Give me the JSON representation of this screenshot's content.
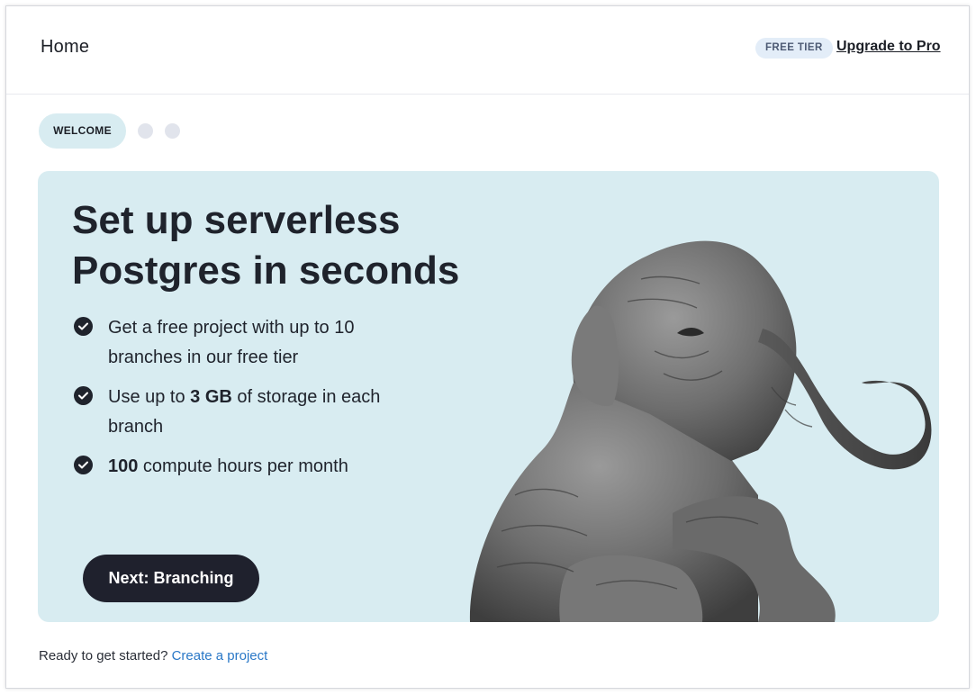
{
  "header": {
    "title": "Home",
    "tier_badge": "FREE TIER",
    "upgrade_link": "Upgrade to Pro"
  },
  "stepper": {
    "active_step": "WELCOME",
    "total_steps": 3,
    "active_index": 0
  },
  "hero": {
    "title_line1": "Set up serverless",
    "title_line2": "Postgres in seconds",
    "features": [
      {
        "prefix": "Get a free project with up to 10 branches in our free tier",
        "bold": "",
        "suffix": ""
      },
      {
        "prefix": "Use up to ",
        "bold": "3 GB",
        "suffix": " of storage in each branch"
      },
      {
        "prefix": "",
        "bold": "100",
        "suffix": " compute hours per month"
      }
    ],
    "next_button": "Next: Branching",
    "image": "elephant-illustration"
  },
  "footer": {
    "prompt": "Ready to get started? ",
    "link": "Create a project"
  },
  "colors": {
    "hero_background": "#d8ecf1",
    "button_background": "#1f212d",
    "link": "#2a78c7",
    "badge_background": "#e3edf8"
  }
}
